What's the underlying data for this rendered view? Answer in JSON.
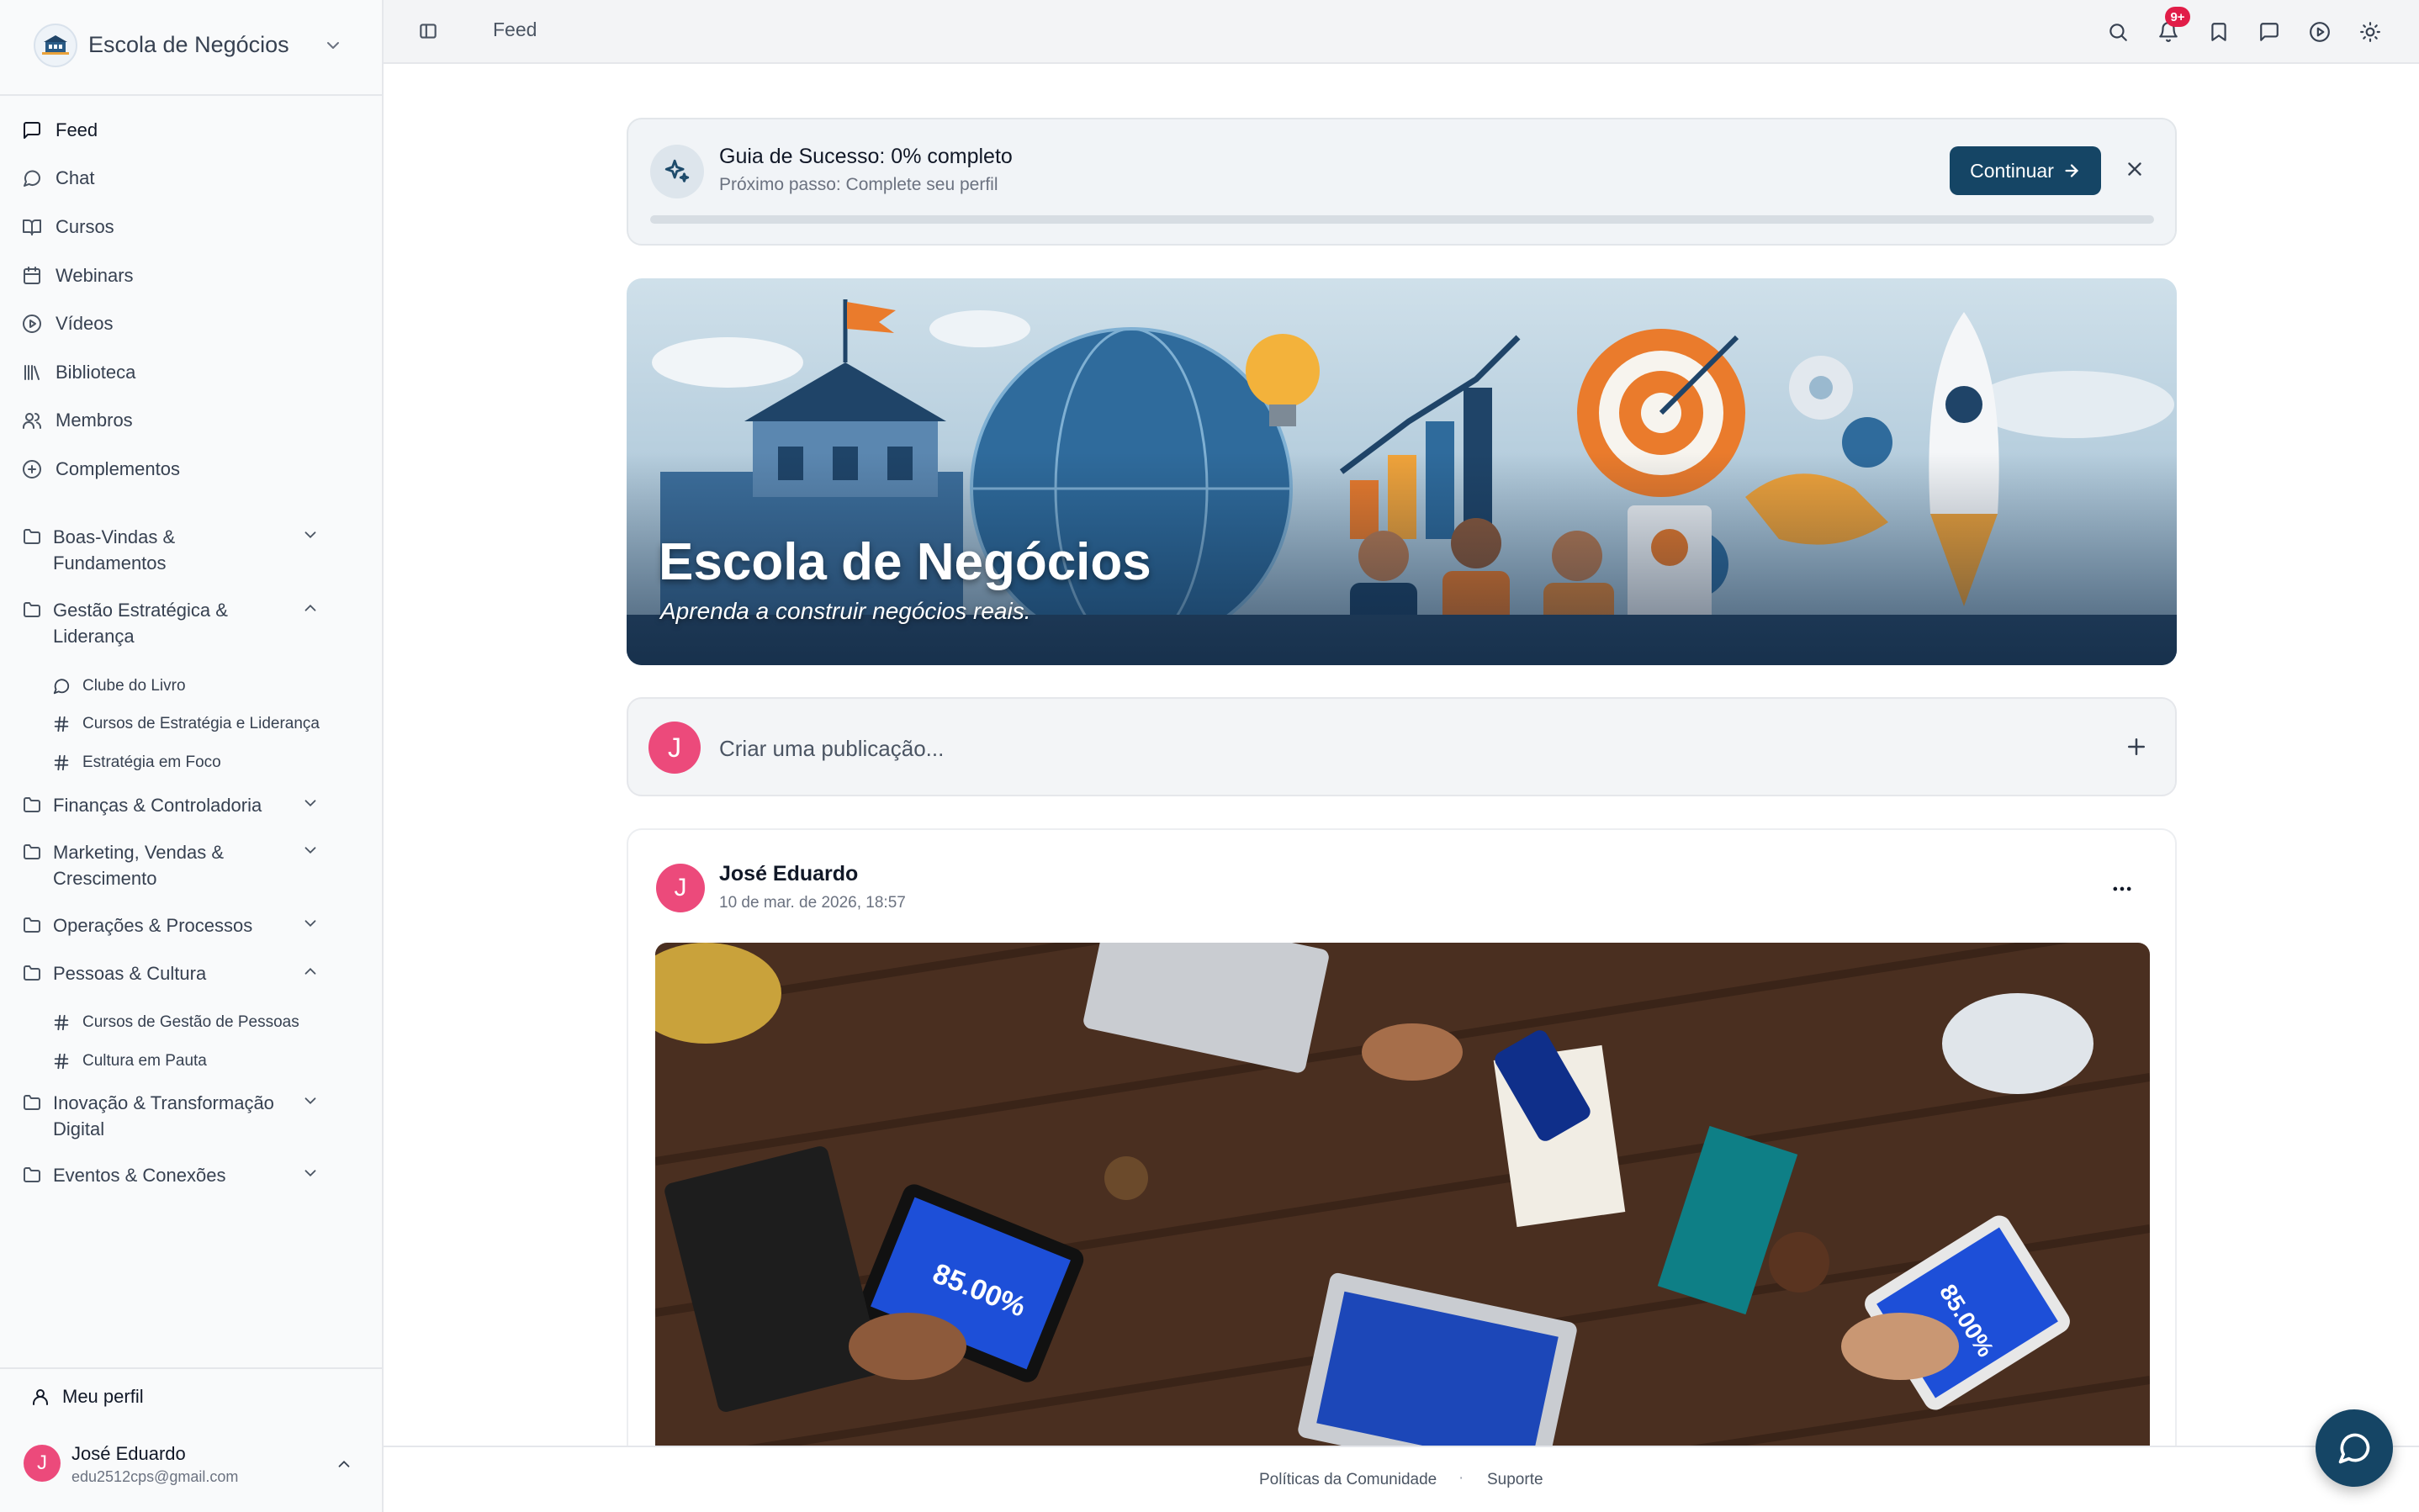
{
  "brand": {
    "name": "Escola de Negócios"
  },
  "nav": {
    "items": [
      {
        "label": "Feed",
        "icon": "message-square-icon"
      },
      {
        "label": "Chat",
        "icon": "message-circle-icon"
      },
      {
        "label": "Cursos",
        "icon": "book-open-icon"
      },
      {
        "label": "Webinars",
        "icon": "calendar-icon"
      },
      {
        "label": "Vídeos",
        "icon": "play-circle-icon"
      },
      {
        "label": "Biblioteca",
        "icon": "library-icon"
      },
      {
        "label": "Membros",
        "icon": "users-icon"
      },
      {
        "label": "Complementos",
        "icon": "plus-circle-icon"
      }
    ]
  },
  "groups": [
    {
      "line1": "Boas-Vindas &",
      "line2": "Fundamentos",
      "expanded": false
    },
    {
      "line1": "Gestão Estratégica &",
      "line2": "Liderança",
      "expanded": true,
      "children": [
        {
          "label": "Clube do Livro",
          "icon": "message-circle-icon"
        },
        {
          "label": "Cursos de Estratégia e Liderança",
          "icon": "hash-icon"
        },
        {
          "label": "Estratégia em Foco",
          "icon": "hash-icon"
        }
      ]
    },
    {
      "line1": "Finanças & Controladoria",
      "line2": "",
      "expanded": false
    },
    {
      "line1": "Marketing, Vendas &",
      "line2": "Crescimento",
      "expanded": false
    },
    {
      "line1": "Operações & Processos",
      "line2": "",
      "expanded": false
    },
    {
      "line1": "Pessoas & Cultura",
      "line2": "",
      "expanded": true,
      "children": [
        {
          "label": "Cursos de Gestão de Pessoas",
          "icon": "hash-icon"
        },
        {
          "label": "Cultura em Pauta",
          "icon": "hash-icon"
        }
      ]
    },
    {
      "line1": "Inovação & Transformação",
      "line2": "Digital",
      "expanded": false
    },
    {
      "line1": "Eventos & Conexões",
      "line2": "",
      "expanded": false
    }
  ],
  "sidebar_bottom": {
    "profile_link": "Meu perfil",
    "user": {
      "initial": "J",
      "name": "José Eduardo",
      "email": "edu2512cps@gmail.com"
    }
  },
  "topbar": {
    "title": "Feed",
    "notification_badge": "9+",
    "icons": [
      "search-icon",
      "bell-icon",
      "bookmark-icon",
      "message-square-icon",
      "play-circle-icon",
      "sun-icon"
    ]
  },
  "guide": {
    "title": "Guia de Sucesso: 0% completo",
    "subtitle": "Próximo passo: Complete seu perfil",
    "button": "Continuar",
    "progress": 0
  },
  "banner": {
    "title": "Escola de Negócios",
    "subtitle": "Aprenda a construir negócios reais."
  },
  "composer": {
    "initial": "J",
    "placeholder": "Criar uma publicação..."
  },
  "post": {
    "initial": "J",
    "author": "José Eduardo",
    "date": "10 de mar. de 2026, 18:57",
    "image_labels": {
      "left_tablet": "85.00%",
      "right_tablet": "85.00%"
    }
  },
  "footer": {
    "links": [
      "Políticas da Comunidade",
      "Suporte"
    ]
  },
  "colors": {
    "accent": "#154565",
    "avatar": "#ec4a7b",
    "badge": "#e11d48"
  }
}
